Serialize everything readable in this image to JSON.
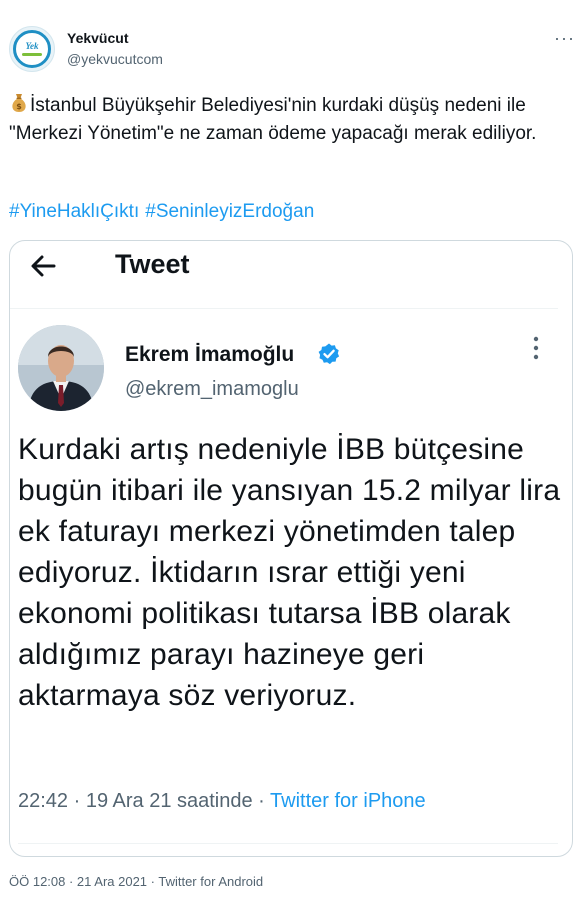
{
  "author": {
    "display_name": "Yekvücut",
    "handle": "@yekvucutcom",
    "logo_text": "Yek"
  },
  "tweet": {
    "text": "İstanbul Büyükşehir Belediyesi'nin kurdaki düşüş nedeni ile \"Merkezi Yönetim\"e ne zaman ödeme yapacağı merak ediliyor.",
    "hashtags": [
      "#YineHaklıÇıktı",
      "#SeninleyizErdoğan"
    ]
  },
  "embedded": {
    "title": "Tweet",
    "author_name": "Ekrem İmamoğlu",
    "author_handle": "@ekrem_imamoglu",
    "text": "Kurdaki artış nedeniyle İBB bütçesine bugün itibari ile yansıyan 15.2 milyar lira ek faturayı merkezi yönetimden talep ediyoruz. İktidarın ısrar ettiği yeni ekonomi politikası tutarsa İBB olarak aldığımız parayı hazineye geri aktarmaya söz veriyoruz.",
    "time": "22:42 · 19 Ara 21 saatinde ·",
    "client": "Twitter for iPhone"
  },
  "footer": {
    "meta": "ÖÖ 12:08 · 21 Ara 2021 · Twitter for Android"
  },
  "colors": {
    "link": "#1d9bf0",
    "secondary_text": "#536471",
    "border": "#cfd9de"
  },
  "icons": [
    "money-bag-icon",
    "more-icon",
    "back-arrow-icon",
    "verified-badge-icon"
  ]
}
